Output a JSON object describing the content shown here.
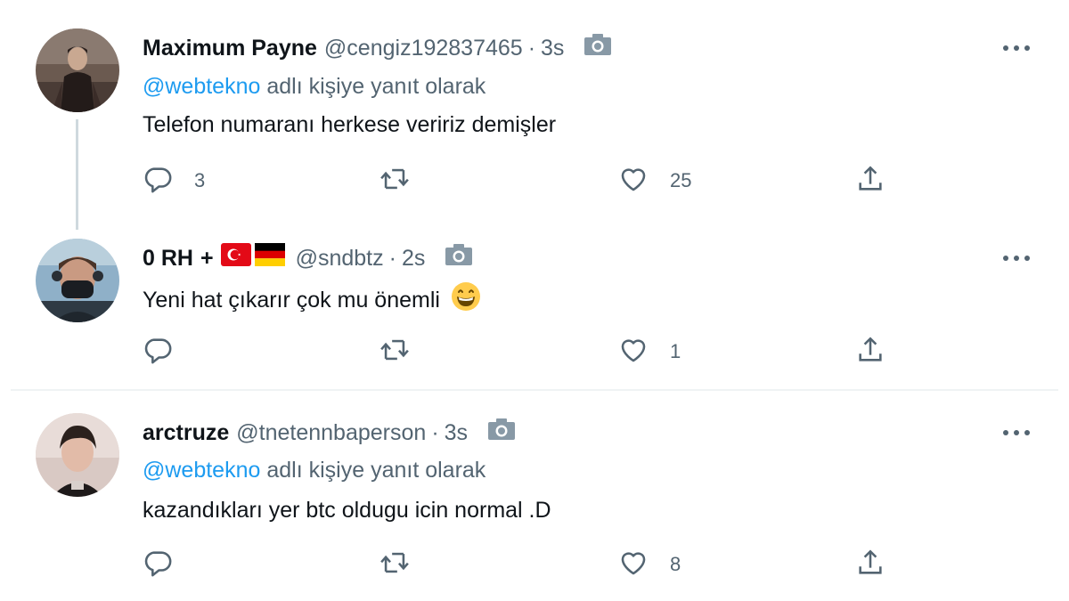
{
  "tweets": [
    {
      "name": "Maximum Payne",
      "handle": "@cengiz192837465",
      "separator": "·",
      "time": "3s",
      "reply_prefix": "@webtekno",
      "reply_suffix": " adlı kişiye yanıt olarak",
      "text": "Telefon numaranı herkese veririz demişler",
      "counts": {
        "reply": "3",
        "retweet": "",
        "like": "25"
      }
    },
    {
      "name": "0 RH",
      "name_plus": "+",
      "flags": [
        "turkey-flag",
        "germany-flag"
      ],
      "handle": "@sndbtz",
      "separator": "·",
      "time": "2s",
      "text": "Yeni hat çıkarır çok mu önemli",
      "emoji": "grinning-face-emoji",
      "counts": {
        "reply": "",
        "retweet": "",
        "like": "1"
      }
    },
    {
      "name": "arctruze",
      "handle": "@tnetennbaperson",
      "separator": "·",
      "time": "3s",
      "reply_prefix": "@webtekno",
      "reply_suffix": " adlı kişiye yanıt olarak",
      "text": "kazandıkları yer btc oldugu icin normal .D",
      "counts": {
        "reply": "",
        "retweet": "",
        "like": "8"
      }
    }
  ],
  "icons": {
    "reply": "reply-icon",
    "retweet": "retweet-icon",
    "like": "like-icon",
    "share": "share-icon",
    "more": "more-icon",
    "camera": "camera-icon"
  },
  "colors": {
    "text": "#0f1419",
    "secondary": "#536471",
    "mention": "#1d9bf0",
    "icon": "#536471",
    "camera": "#8899a6"
  }
}
